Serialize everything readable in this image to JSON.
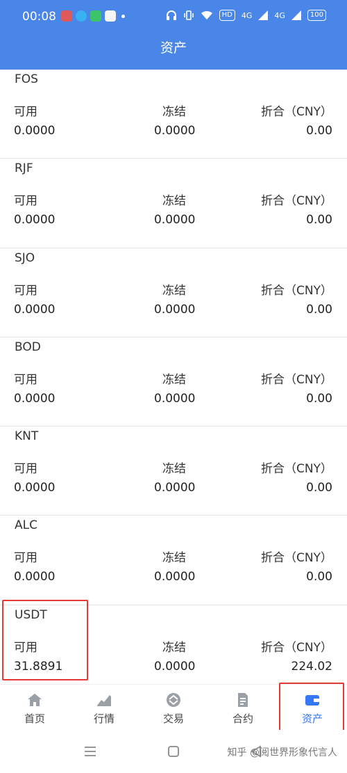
{
  "status": {
    "time": "00:08",
    "signal_a": "4G",
    "signal_b": "4G",
    "hd": "HD",
    "battery": "100"
  },
  "title": "资产",
  "labels": {
    "available": "可用",
    "frozen": "冻结",
    "converted": "折合（CNY）"
  },
  "assets": [
    {
      "name": "FOS",
      "available": "0.0000",
      "frozen": "0.0000",
      "cny": "0.00"
    },
    {
      "name": "RJF",
      "available": "0.0000",
      "frozen": "0.0000",
      "cny": "0.00"
    },
    {
      "name": "SJO",
      "available": "0.0000",
      "frozen": "0.0000",
      "cny": "0.00"
    },
    {
      "name": "BOD",
      "available": "0.0000",
      "frozen": "0.0000",
      "cny": "0.00"
    },
    {
      "name": "KNT",
      "available": "0.0000",
      "frozen": "0.0000",
      "cny": "0.00"
    },
    {
      "name": "ALC",
      "available": "0.0000",
      "frozen": "0.0000",
      "cny": "0.00"
    },
    {
      "name": "USDT",
      "available": "31.8891",
      "frozen": "0.0000",
      "cny": "224.02"
    }
  ],
  "tabs": [
    {
      "label": "首页",
      "icon": "home-icon"
    },
    {
      "label": "行情",
      "icon": "chart-icon"
    },
    {
      "label": "交易",
      "icon": "exchange-icon"
    },
    {
      "label": "合约",
      "icon": "document-icon"
    },
    {
      "label": "资产",
      "icon": "wallet-icon"
    }
  ],
  "watermark": "知乎 @阅世界形象代言人",
  "colors": {
    "header": "#4a86e8",
    "active_tab": "#3478f6",
    "highlight": "#e53935"
  }
}
